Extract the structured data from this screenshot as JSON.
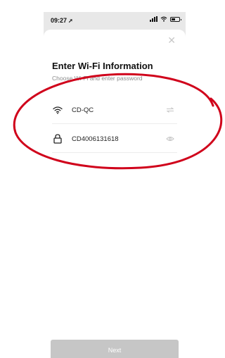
{
  "status_bar": {
    "time": "09:27",
    "location_arrow": "➚"
  },
  "sheet": {
    "close_icon": "close-icon",
    "title": "Enter Wi-Fi Information",
    "subtitle": "Choose Wi-Fi and enter password",
    "wifi": {
      "icon": "wifi-icon",
      "value": "CD-QC",
      "action_icon": "switch-network-icon"
    },
    "password": {
      "icon": "lock-icon",
      "value": "CD4006131618",
      "action_icon": "eye-icon"
    },
    "next_label": "Next"
  },
  "colors": {
    "annotation": "#d0021b",
    "button_disabled": "#c6c6c6"
  }
}
